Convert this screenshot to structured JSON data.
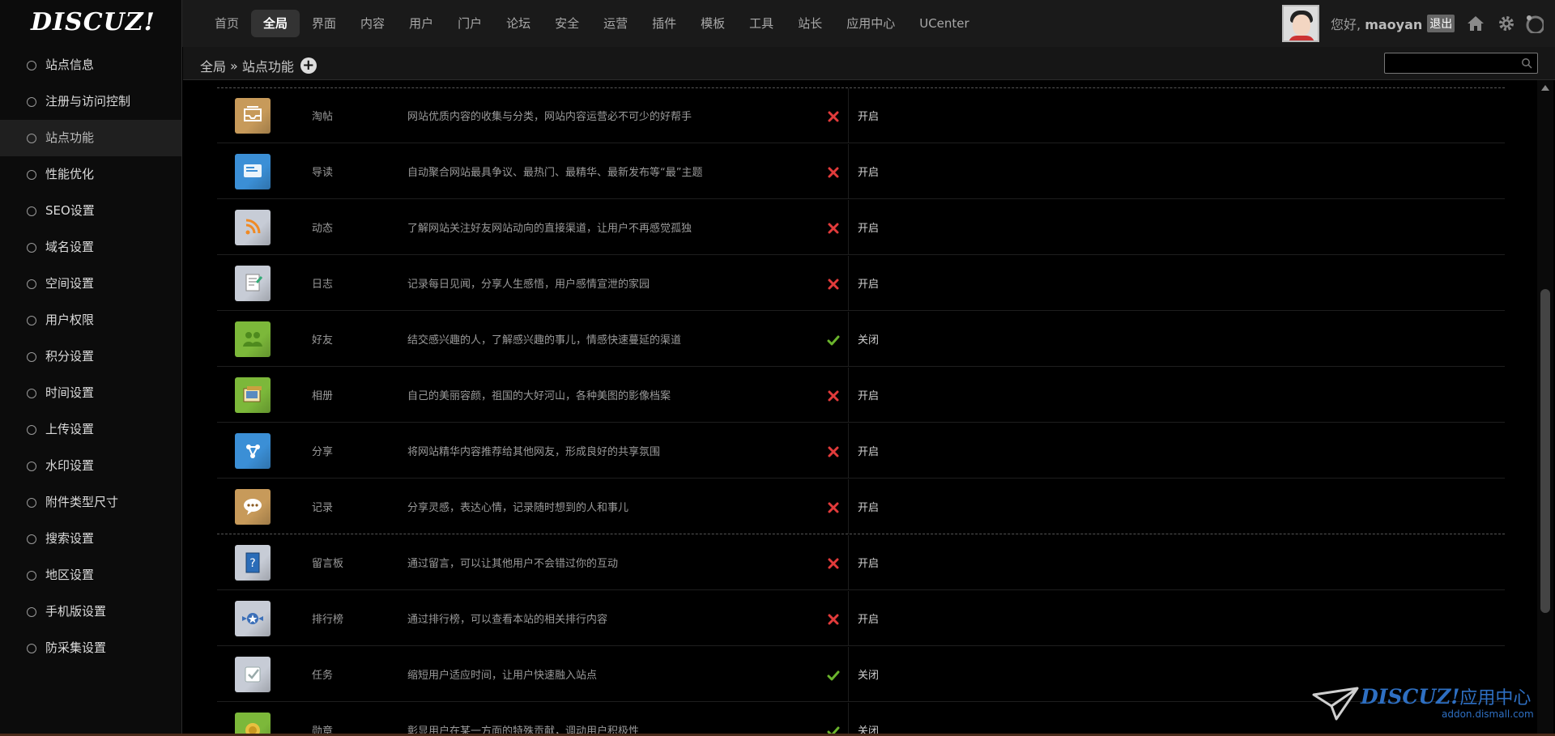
{
  "header": {
    "logo": "DISCUZ!",
    "nav": [
      "首页",
      "全局",
      "界面",
      "内容",
      "用户",
      "门户",
      "论坛",
      "安全",
      "运营",
      "插件",
      "模板",
      "工具",
      "站长",
      "应用中心",
      "UCenter"
    ],
    "active_nav": "全局",
    "greeting_prefix": "您好,",
    "username": "maoyan",
    "logout_label": "退出"
  },
  "sidebar": {
    "items": [
      "站点信息",
      "注册与访问控制",
      "站点功能",
      "性能优化",
      "SEO设置",
      "域名设置",
      "空间设置",
      "用户权限",
      "积分设置",
      "时间设置",
      "上传设置",
      "水印设置",
      "附件类型尺寸",
      "搜索设置",
      "地区设置",
      "手机版设置",
      "防采集设置"
    ],
    "active": "站点功能"
  },
  "breadcrumb": {
    "root": "全局",
    "separator": "»",
    "current": "站点功能"
  },
  "search": {
    "placeholder": ""
  },
  "features": [
    {
      "name": "淘帖",
      "desc": "网站优质内容的收集与分类，网站内容运营必不可少的好帮手",
      "enabled": false,
      "action": "开启",
      "icon": "collection-icon",
      "color": "#c79a5a"
    },
    {
      "name": "导读",
      "desc": "自动聚合网站最具争议、最热门、最精华、最新发布等“最”主题",
      "enabled": false,
      "action": "开启",
      "icon": "guide-icon",
      "color": "#3b8fd6"
    },
    {
      "name": "动态",
      "desc": "了解网站关注好友网站动向的直接渠道，让用户不再感觉孤独",
      "enabled": false,
      "action": "开启",
      "icon": "feed-icon",
      "color": "#c7ccd6"
    },
    {
      "name": "日志",
      "desc": "记录每日见闻，分享人生感悟，用户感情宣泄的家园",
      "enabled": false,
      "action": "开启",
      "icon": "blog-icon",
      "color": "#c7ccd6"
    },
    {
      "name": "好友",
      "desc": "结交感兴趣的人，了解感兴趣的事儿，情感快速蔓延的渠道",
      "enabled": true,
      "action": "关闭",
      "icon": "friends-icon",
      "color": "#7cb83a"
    },
    {
      "name": "相册",
      "desc": "自己的美丽容颜，祖国的大好河山，各种美图的影像档案",
      "enabled": false,
      "action": "开启",
      "icon": "album-icon",
      "color": "#7cb83a"
    },
    {
      "name": "分享",
      "desc": "将网站精华内容推荐给其他网友，形成良好的共享氛围",
      "enabled": false,
      "action": "开启",
      "icon": "share-icon",
      "color": "#3b8fd6"
    },
    {
      "name": "记录",
      "desc": "分享灵感，表达心情，记录随时想到的人和事儿",
      "enabled": false,
      "action": "开启",
      "icon": "doing-icon",
      "color": "#c79a5a"
    },
    {
      "name": "留言板",
      "desc": "通过留言，可以让其他用户不会错过你的互动",
      "enabled": false,
      "action": "开启",
      "icon": "guestbook-icon",
      "color": "#c7ccd6"
    },
    {
      "name": "排行榜",
      "desc": "通过排行榜，可以查看本站的相关排行内容",
      "enabled": false,
      "action": "开启",
      "icon": "ranklist-icon",
      "color": "#c7ccd6"
    },
    {
      "name": "任务",
      "desc": "缩短用户适应时间，让用户快速融入站点",
      "enabled": true,
      "action": "关闭",
      "icon": "task-icon",
      "color": "#c7ccd6"
    },
    {
      "name": "勋章",
      "desc": "彰显用户在某一方面的特殊贡献，调动用户积极性",
      "enabled": true,
      "action": "关闭",
      "icon": "medal-icon",
      "color": "#7cb83a"
    }
  ],
  "watermark": {
    "brand": "DISCUZ!",
    "label": "应用中心",
    "url": "addon.dismall.com"
  }
}
